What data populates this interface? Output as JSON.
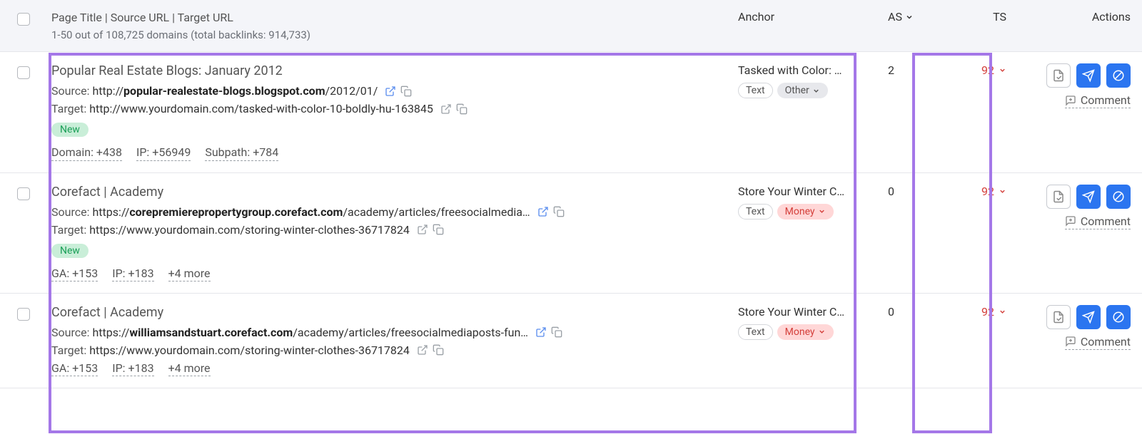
{
  "header": {
    "title": "Page Title | Source URL | Target URL",
    "subtitle": "1-50 out of 108,725 domains (total backlinks: 914,733)",
    "anchor": "Anchor",
    "as": "AS",
    "ts": "TS",
    "actions": "Actions"
  },
  "rows": [
    {
      "page_title": "Popular Real Estate Blogs: January 2012",
      "source_label": "Source:",
      "source_prefix": "http://",
      "source_bold": "popular-realestate-blogs.blogspot.com",
      "source_tail": "/2012/01/",
      "target_label": "Target:",
      "target_url": "http://www.yourdomain.com/tasked-with-color-10-boldly-hu-163845",
      "new_badge": "New",
      "meta": [
        "Domain: +438",
        "IP: +56949",
        "Subpath: +784"
      ],
      "anchor": "Tasked with Color: …",
      "tags": [
        {
          "label": "Text",
          "type": "text"
        },
        {
          "label": "Other",
          "type": "other",
          "caret": true
        }
      ],
      "as": "2",
      "ts": "92",
      "comment": "Comment"
    },
    {
      "page_title": "Corefact | Academy",
      "source_label": "Source:",
      "source_prefix": "https://",
      "source_bold": "corepremierepropertygroup.corefact.com",
      "source_tail": "/academy/articles/freesocialmedia…",
      "target_label": "Target:",
      "target_url": "https://www.yourdomain.com/storing-winter-clothes-36717824",
      "new_badge": "New",
      "meta": [
        "GA: +153",
        "IP: +183",
        "+4 more"
      ],
      "anchor": "Store Your Winter C…",
      "tags": [
        {
          "label": "Text",
          "type": "text"
        },
        {
          "label": "Money",
          "type": "money",
          "caret": true
        }
      ],
      "as": "0",
      "ts": "92",
      "comment": "Comment"
    },
    {
      "page_title": "Corefact | Academy",
      "source_label": "Source:",
      "source_prefix": "https://",
      "source_bold": "williamsandstuart.corefact.com",
      "source_tail": "/academy/articles/freesocialmediaposts-fun…",
      "target_label": "Target:",
      "target_url": "https://www.yourdomain.com/storing-winter-clothes-36717824",
      "new_badge": "",
      "meta": [
        "GA: +153",
        "IP: +183",
        "+4 more"
      ],
      "anchor": "Store Your Winter C…",
      "tags": [
        {
          "label": "Text",
          "type": "text"
        },
        {
          "label": "Money",
          "type": "money",
          "caret": true
        }
      ],
      "as": "0",
      "ts": "92",
      "comment": "Comment"
    }
  ]
}
